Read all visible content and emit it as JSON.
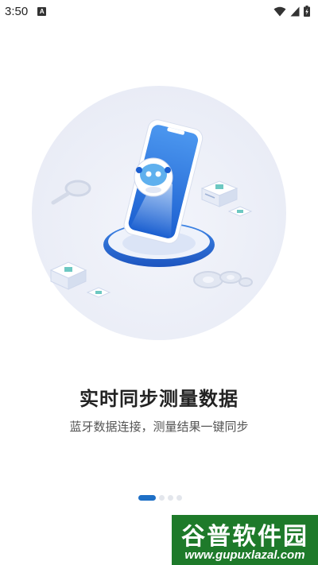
{
  "status_bar": {
    "time": "3:50",
    "notification_badge": "A",
    "icons": [
      "wifi-icon",
      "signal-icon",
      "battery-charging-icon"
    ]
  },
  "onboarding": {
    "title": "实时同步测量数据",
    "subtitle": "蓝牙数据连接，测量结果一键同步",
    "page_indicator": {
      "total": 4,
      "current": 1
    }
  },
  "watermark": {
    "title": "谷普软件园",
    "url": "www.gupuxlazal.com"
  },
  "colors": {
    "accent": "#1e6fc6",
    "watermark_bg": "#1e7a2a",
    "title_text": "#222222",
    "subtitle_text": "#555555"
  }
}
